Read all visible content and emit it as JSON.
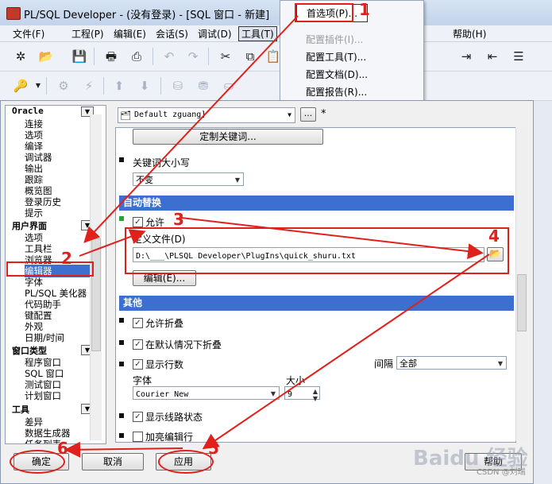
{
  "window": {
    "title": "PL/SQL Developer - (没有登录) - [SQL 窗口 - 新建]"
  },
  "menubar": {
    "items": [
      "文件(F)",
      "工程(P)",
      "编辑(E)",
      "会话(S)",
      "调试(D)",
      "工具(T)"
    ],
    "help": "帮助(H)"
  },
  "tools_menu": {
    "items": [
      {
        "label": "首选项(P)...",
        "disabled": false
      },
      {
        "label": "配置插件(I)...",
        "disabled": true
      },
      {
        "label": "配置工具(T)...",
        "disabled": false
      },
      {
        "label": "配置文档(D)...",
        "disabled": false
      },
      {
        "label": "配置报告(R)...",
        "disabled": false
      }
    ]
  },
  "left_panel": {
    "categories": [
      {
        "name": "Oracle",
        "items": [
          "连接",
          "选项",
          "编译",
          "调试器",
          "输出",
          "跟踪",
          "概览图",
          "登录历史",
          "提示"
        ]
      },
      {
        "name": "用户界面",
        "items": [
          "选项",
          "工具栏",
          "浏览器",
          "编辑器",
          "字体",
          "PL/SQL 美化器",
          "代码助手",
          "键配置",
          "外观",
          "日期/时间"
        ],
        "selected": "编辑器"
      },
      {
        "name": "窗口类型",
        "items": [
          "程序窗口",
          "SQL 窗口",
          "测试窗口",
          "计划窗口"
        ]
      },
      {
        "name": "工具",
        "items": [
          "差异",
          "数据生成器",
          "任务列表"
        ]
      }
    ]
  },
  "profile": {
    "value": "Default zguang]",
    "ellipsis": "...",
    "star": "*"
  },
  "editor": {
    "custom_keyword_button": "定制关键词...",
    "keyword_case_label": "关键词大小写",
    "keyword_case_value": "不变",
    "autoreplace_header": "自动替换",
    "allow_label": "允许",
    "allow_checked": true,
    "def_file_label": "定义文件(D)",
    "def_file_value": "D:\\___\\PLSQL Developer\\PlugIns\\quick_shuru.txt",
    "edit_button": "编辑(E)...",
    "other_header": "其他",
    "allow_fold_label": "允许折叠",
    "allow_fold_checked": true,
    "fold_default_label": "在默认情况下折叠",
    "fold_default_checked": true,
    "show_line_numbers_label": "显示行数",
    "show_line_numbers_checked": true,
    "interval_label": "间隔",
    "interval_value": "全部",
    "font_label": "字体",
    "font_value": "Courier New",
    "size_label": "大小",
    "size_value": "9",
    "show_path_label": "显示线路状态",
    "show_path_checked": true,
    "highlight_line_label": "加亮编辑行"
  },
  "buttons": {
    "ok": "确定",
    "cancel": "取消",
    "apply": "应用",
    "help": "帮助"
  },
  "annotations": {
    "n1": "1",
    "n2": "2",
    "n3": "3",
    "n4": "4",
    "n5": "5",
    "n6": "6"
  },
  "watermark": {
    "brand": "Baidu 经验",
    "credit": "CSDN @刘瑞"
  },
  "colors": {
    "accent": "#3d6fd0",
    "annotation": "#e0211b"
  }
}
